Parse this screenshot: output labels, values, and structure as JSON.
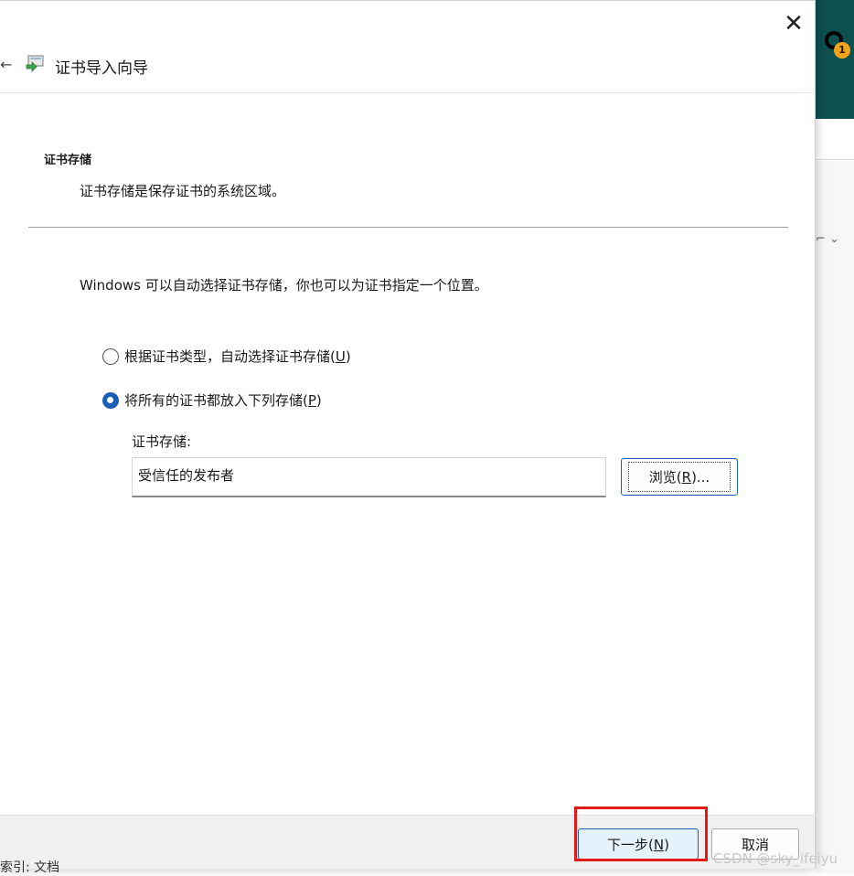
{
  "background": {
    "notification_count": "1",
    "bottom_text": "索引: 文档"
  },
  "dialog": {
    "title": "证书导入向导",
    "close_label": "✕",
    "section_title": "证书存储",
    "section_desc": "证书存储是保存证书的系统区域。",
    "intro": "Windows 可以自动选择证书存储，你也可以为证书指定一个位置。",
    "options": [
      {
        "label_pre": "根据证书类型，自动选择证书存储(",
        "mnemonic": "U",
        "label_post": ")",
        "selected": false
      },
      {
        "label_pre": "将所有的证书都放入下列存储(",
        "mnemonic": "P",
        "label_post": ")",
        "selected": true
      }
    ],
    "store_label": "证书存储:",
    "store_value": "受信任的发布者",
    "browse": {
      "pre": "浏览(",
      "mnemonic": "R",
      "post": ")..."
    },
    "next": {
      "pre": "下一步(",
      "mnemonic": "N",
      "post": ")"
    },
    "cancel_label": "取消"
  },
  "watermark": "CSDN @sky_ifeiyu",
  "colors": {
    "accent": "#1a5fb4",
    "highlight": "#e11b1b",
    "teal": "#0e4f4f",
    "badge": "#f2a41c"
  }
}
